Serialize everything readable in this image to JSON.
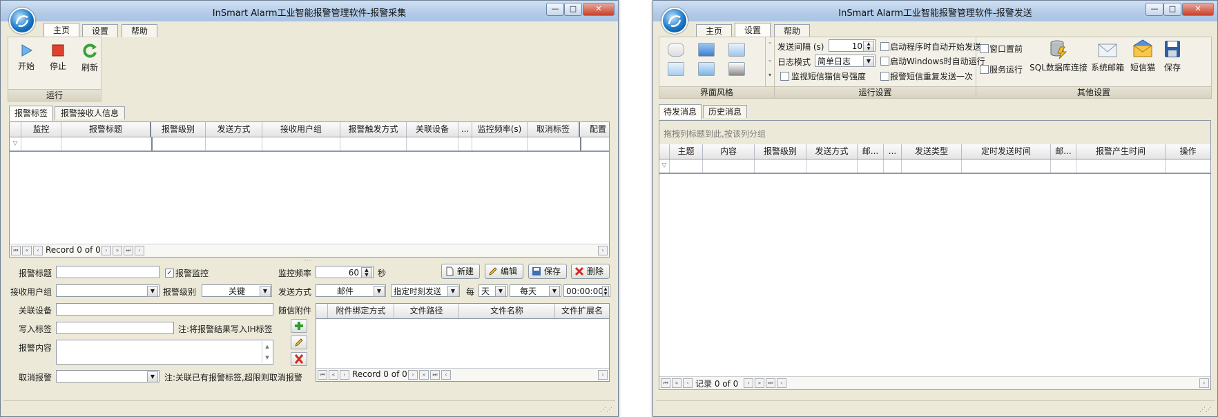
{
  "window_left": {
    "title": "InSmart Alarm工业智能报警管理软件-报警采集",
    "menu_tabs": [
      "主页",
      "设置",
      "帮助"
    ],
    "ribbon_buttons": {
      "start": "开始",
      "stop": "停止",
      "refresh": "刷新"
    },
    "ribbon_group": "运行",
    "subtabs": [
      "报警标签",
      "报警接收人信息"
    ],
    "grid_columns": [
      "监控",
      "报警标题",
      "报警级别",
      "发送方式",
      "接收用户组",
      "报警触发方式",
      "关联设备",
      "...",
      "监控频率(s)",
      "取消标签",
      "配置"
    ],
    "record_label": "Record 0 of 0",
    "form": {
      "alarm_title_label": "报警标题",
      "alarm_monitor_label": "报警监控",
      "monitor_freq_label": "监控频率",
      "monitor_freq_value": "60",
      "sec_label": "秒",
      "receive_group_label": "接收用户组",
      "alarm_level_label": "报警级别",
      "alarm_level_value": "关键",
      "send_mode_label": "发送方式",
      "send_mode_value": "邮件",
      "schedule_value": "指定时刻发送",
      "every_label": "每",
      "unit_value": "天",
      "period_value": "每天",
      "time_value": "00:00:00",
      "device_label": "关联设备",
      "attachment_label": "随信附件",
      "write_tag_label": "写入标签",
      "write_tag_note": "注:将报警结果写入IH标签",
      "content_label": "报警内容",
      "cancel_label": "取消报警",
      "cancel_note": "注:关联已有报警标签,超限则取消报警"
    },
    "buttons": {
      "new": "新建",
      "edit": "编辑",
      "save": "保存",
      "delete": "删除"
    },
    "attach_columns": [
      "附件绑定方式",
      "文件路径",
      "文件名称",
      "文件扩展名"
    ],
    "attach_record_label": "Record 0 of 0"
  },
  "window_right": {
    "title": "InSmart Alarm工业智能报警管理软件-报警发送",
    "menu_tabs": [
      "主页",
      "设置",
      "帮助"
    ],
    "group_labels": {
      "style": "界面风格",
      "run": "运行设置",
      "other": "其他设置"
    },
    "run": {
      "send_interval_label": "发送间隔 (s)",
      "send_interval_value": "10",
      "log_mode_label": "日志模式",
      "log_mode_value": "简单日志",
      "monitor_signal_label": "监视短信猫信号强度",
      "auto_send_label": "启动程序时自动开始发送",
      "auto_run_label": "启动Windows时自动运行",
      "resend_label": "报警短信重复发送一次"
    },
    "other": {
      "window_top_label": "窗口置前",
      "service_label": "服务运行",
      "sql_label": "SQL数据库连接",
      "mail_label": "系统邮箱",
      "sms_label": "短信猫",
      "save_label": "保存"
    },
    "subtabs": [
      "待发消息",
      "历史消息"
    ],
    "group_hint": "拖拽列标题到此,按该列分组",
    "grid_columns": [
      "主题",
      "内容",
      "报警级别",
      "发送方式",
      "邮...",
      "...",
      "发送类型",
      "定时发送时间",
      "邮...",
      "报警产生时间",
      "操作"
    ],
    "record_label": "记录 0 of 0"
  }
}
